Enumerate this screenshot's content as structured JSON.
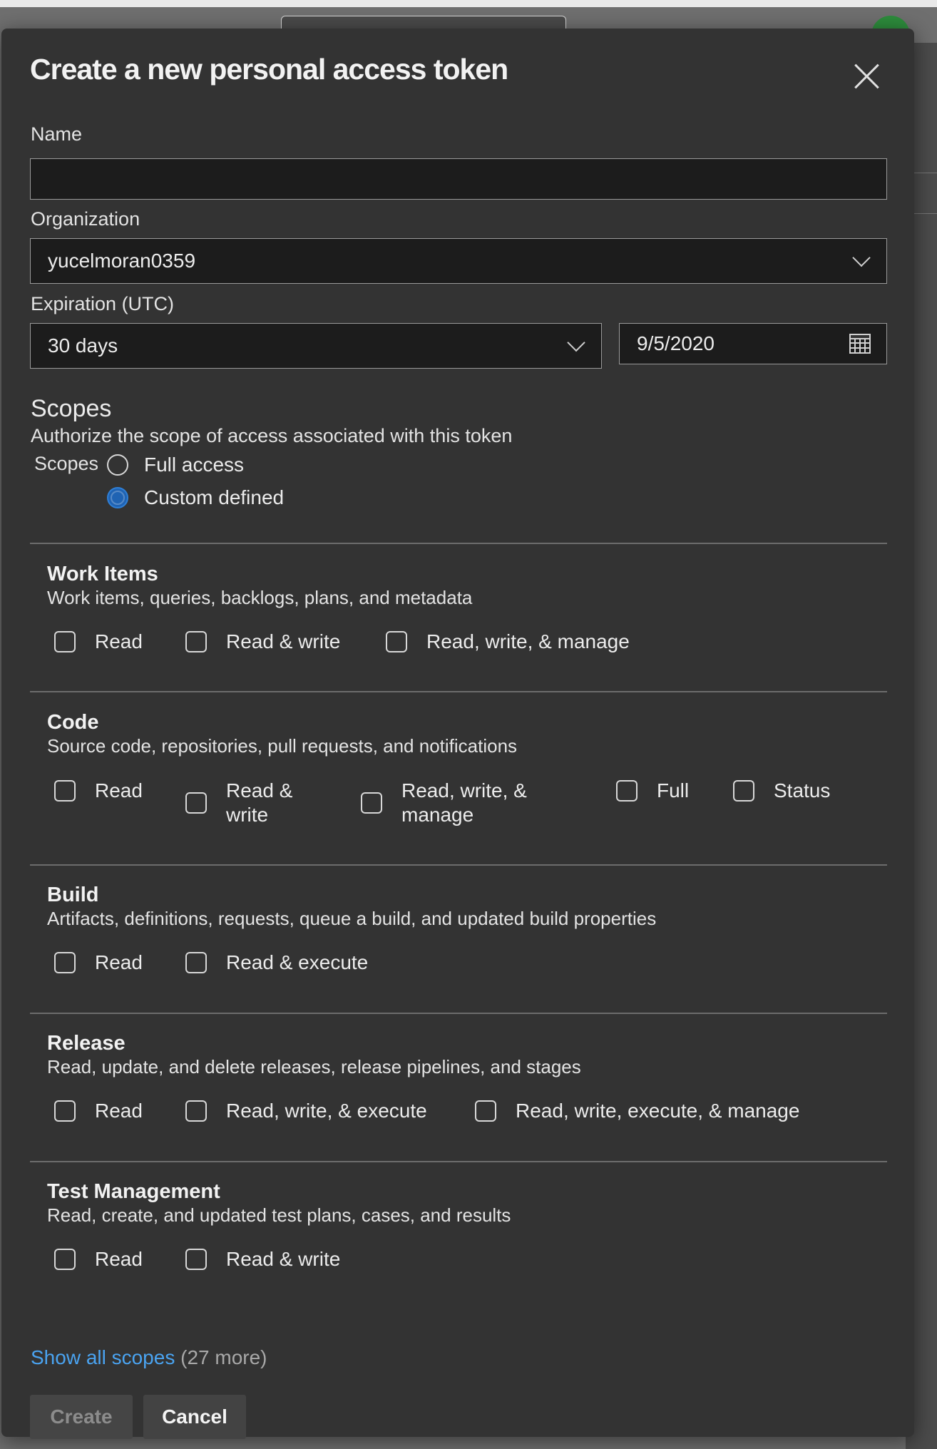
{
  "dialog": {
    "title": "Create a new personal access token"
  },
  "form": {
    "name_label": "Name",
    "name_value": "",
    "organization_label": "Organization",
    "organization_value": "yucelmoran0359",
    "expiration_label": "Expiration (UTC)",
    "expiration_value": "30 days",
    "expiration_date": "9/5/2020"
  },
  "scopes": {
    "heading": "Scopes",
    "description": "Authorize the scope of access associated with this token",
    "label": "Scopes",
    "options": [
      {
        "label": "Full access",
        "selected": false
      },
      {
        "label": "Custom defined",
        "selected": true
      }
    ]
  },
  "sections": [
    {
      "title": "Work Items",
      "description": "Work items, queries, backlogs, plans, and metadata",
      "options": [
        "Read",
        "Read & write",
        "Read, write, & manage"
      ]
    },
    {
      "title": "Code",
      "description": "Source code, repositories, pull requests, and notifications",
      "options": [
        "Read",
        "Read & write",
        "Read, write, & manage",
        "Full",
        "Status"
      ]
    },
    {
      "title": "Build",
      "description": "Artifacts, definitions, requests, queue a build, and updated build properties",
      "options": [
        "Read",
        "Read & execute"
      ]
    },
    {
      "title": "Release",
      "description": "Read, update, and delete releases, release pipelines, and stages",
      "options": [
        "Read",
        "Read, write, & execute",
        "Read, write, execute, & manage"
      ]
    },
    {
      "title": "Test Management",
      "description": "Read, create, and updated test plans, cases, and results",
      "options": [
        "Read",
        "Read & write"
      ]
    }
  ],
  "footer": {
    "show_all_link": "Show all scopes",
    "show_all_count": "(27 more)",
    "create_label": "Create",
    "cancel_label": "Cancel"
  },
  "colors": {
    "dialog_bg": "#333333",
    "input_bg": "#1c1c1c",
    "link": "#4aa3f0",
    "radio_selected": "#1f63b3"
  }
}
